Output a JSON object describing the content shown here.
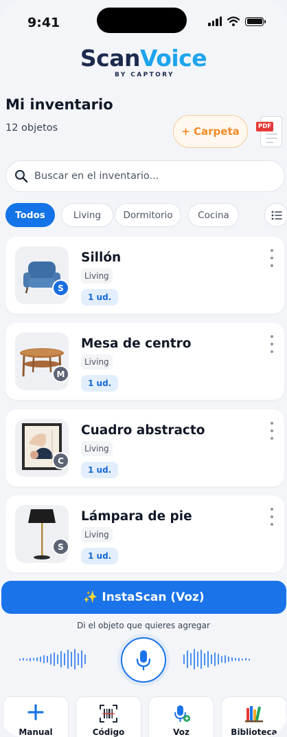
{
  "status_bar": {
    "time": "9:41"
  },
  "logo": {
    "scan": "Scan",
    "voice": "Voice",
    "sub": "BY CAPTORY"
  },
  "header": {
    "title": "Mi inventario",
    "count": "12 objetos",
    "folder_button": "+ Carpeta",
    "pdf_label": "PDF"
  },
  "search": {
    "placeholder": "Buscar en el inventario..."
  },
  "filters": [
    {
      "label": "Todos",
      "active": true
    },
    {
      "label": "Living",
      "active": false
    },
    {
      "label": "Dormitorio",
      "active": false
    },
    {
      "label": "Cocina",
      "active": false
    }
  ],
  "items": [
    {
      "name": "Sillón",
      "room": "Living",
      "qty": "1 ud.",
      "avatar": "S",
      "avatar_color": "#1a6ee0",
      "icon": "armchair-icon"
    },
    {
      "name": "Mesa de centro",
      "room": "Living",
      "qty": "1 ud.",
      "avatar": "M",
      "avatar_color": "#5d6475",
      "icon": "coffee-table-icon"
    },
    {
      "name": "Cuadro abstracto",
      "room": "Living",
      "qty": "1 ud.",
      "avatar": "C",
      "avatar_color": "#5d6475",
      "icon": "framed-painting-icon"
    },
    {
      "name": "Lámpara de pie",
      "room": "Living",
      "qty": "1 ud.",
      "avatar": "S",
      "avatar_color": "#5d6475",
      "icon": "floor-lamp-icon"
    }
  ],
  "voice": {
    "button": "✨ InstaScan (Voz)",
    "hint": "Di el objeto que quieres agregar"
  },
  "actions": [
    {
      "label": "Manual",
      "icon": "plus-icon"
    },
    {
      "label": "Código",
      "icon": "barcode-scan-icon"
    },
    {
      "label": "Voz",
      "icon": "voice-add-icon"
    },
    {
      "label": "Biblioteca",
      "icon": "library-books-icon"
    }
  ],
  "colors": {
    "accent": "#1a73e8",
    "orange": "#ef8b28",
    "brand_dark": "#1c2a4d",
    "brand_light": "#1ea4ec"
  }
}
